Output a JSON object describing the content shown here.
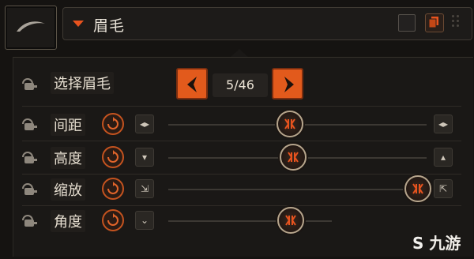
{
  "header": {
    "title": "眉毛",
    "accent": "#e8531e"
  },
  "selector": {
    "label": "选择眉毛",
    "page": "5/46"
  },
  "sliders": [
    {
      "label": "间距",
      "value": 0.5
    },
    {
      "label": "高度",
      "value": 0.5
    },
    {
      "label": "缩放",
      "value": 1.0
    },
    {
      "label": "角度",
      "value": 0.5
    }
  ],
  "icons": {
    "tile": "eyebrow-icon",
    "lock": "lock-icon",
    "reset": "reset-icon",
    "left": "chevron-left-icon",
    "right": "chevron-right-icon"
  },
  "watermark": "九游"
}
